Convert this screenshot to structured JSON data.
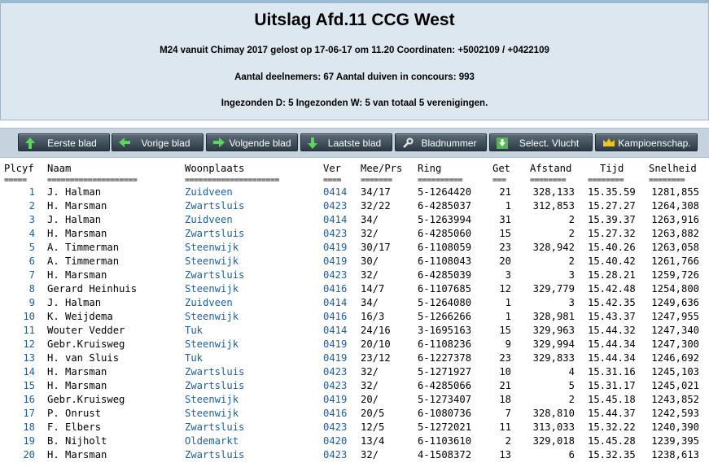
{
  "title": "Uitslag Afd.11 CCG West",
  "info_line1": "M24 vanuit Chimay 2017 gelost op 17-06-17 om 11.20 Coordinaten: +5002109 / +0422109",
  "info_line2": "Aantal deelnemers: 67 Aantal duiven in concours: 993",
  "info_line3": "Ingezonden D: 5 Ingezonden W: 5 van totaal 5 verenigingen.",
  "nav": [
    {
      "label": "Eerste blad",
      "icon": "arrow-up-icon"
    },
    {
      "label": "Vorige blad",
      "icon": "arrow-left-icon"
    },
    {
      "label": "Volgende blad",
      "icon": "arrow-right-icon"
    },
    {
      "label": "Laatste blad",
      "icon": "arrow-down-icon"
    },
    {
      "label": "Bladnummer",
      "icon": "wrench-icon"
    },
    {
      "label": "Select. Vlucht",
      "icon": "download-icon"
    },
    {
      "label": "Kampioenschap.",
      "icon": "crown-icon"
    }
  ],
  "columns": {
    "plcyf": "Plcyf",
    "naam": "Naam",
    "woonplaats": "Woonplaats",
    "ver": "Ver",
    "meeprs": "Mee/Prs",
    "ring": "Ring",
    "get": "Get",
    "afstand": "Afstand",
    "tijd": "Tijd",
    "snelheid": "Snelheid"
  },
  "separators": {
    "plcyf": "=====",
    "naam": "====================",
    "woonplaats": "=====================",
    "ver": "====",
    "meeprs": "=======",
    "ring": "==========",
    "get": "===",
    "afstand": "========",
    "tijd": "========",
    "snelheid": "========"
  },
  "rows": [
    {
      "plcyf": "1",
      "naam": "J. Halman",
      "woonplaats": "Zuidveen",
      "ver": "0414",
      "meeprs": "34/17",
      "ring": "5-1264420",
      "get": "21",
      "afstand": "328,133",
      "tijd": "15.35.59",
      "snelheid": "1281,855"
    },
    {
      "plcyf": "2",
      "naam": "H. Marsman",
      "woonplaats": "Zwartsluis",
      "ver": "0423",
      "meeprs": "32/22",
      "ring": "6-4285037",
      "get": "1",
      "afstand": "312,853",
      "tijd": "15.27.27",
      "snelheid": "1264,308"
    },
    {
      "plcyf": "3",
      "naam": "J. Halman",
      "woonplaats": "Zuidveen",
      "ver": "0414",
      "meeprs": "34/",
      "ring": "5-1263994",
      "get": "31",
      "afstand": "2",
      "tijd": "15.39.37",
      "snelheid": "1263,916"
    },
    {
      "plcyf": "4",
      "naam": "H. Marsman",
      "woonplaats": "Zwartsluis",
      "ver": "0423",
      "meeprs": "32/",
      "ring": "6-4285060",
      "get": "15",
      "afstand": "2",
      "tijd": "15.27.32",
      "snelheid": "1263,882"
    },
    {
      "plcyf": "5",
      "naam": "A. Timmerman",
      "woonplaats": "Steenwijk",
      "ver": "0419",
      "meeprs": "30/17",
      "ring": "6-1108059",
      "get": "23",
      "afstand": "328,942",
      "tijd": "15.40.26",
      "snelheid": "1263,058"
    },
    {
      "plcyf": "6",
      "naam": "A. Timmerman",
      "woonplaats": "Steenwijk",
      "ver": "0419",
      "meeprs": "30/",
      "ring": "6-1108043",
      "get": "20",
      "afstand": "2",
      "tijd": "15.40.42",
      "snelheid": "1261,766"
    },
    {
      "plcyf": "7",
      "naam": "H. Marsman",
      "woonplaats": "Zwartsluis",
      "ver": "0423",
      "meeprs": "32/",
      "ring": "6-4285039",
      "get": "3",
      "afstand": "3",
      "tijd": "15.28.21",
      "snelheid": "1259,726"
    },
    {
      "plcyf": "8",
      "naam": "Gerard Heinhuis",
      "woonplaats": "Steenwijk",
      "ver": "0416",
      "meeprs": "14/7",
      "ring": "6-1107685",
      "get": "12",
      "afstand": "329,779",
      "tijd": "15.42.48",
      "snelheid": "1254,800"
    },
    {
      "plcyf": "9",
      "naam": "J. Halman",
      "woonplaats": "Zuidveen",
      "ver": "0414",
      "meeprs": "34/",
      "ring": "5-1264080",
      "get": "1",
      "afstand": "3",
      "tijd": "15.42.35",
      "snelheid": "1249,636"
    },
    {
      "plcyf": "10",
      "naam": "K. Weijdema",
      "woonplaats": "Steenwijk",
      "ver": "0416",
      "meeprs": "16/3",
      "ring": "5-1266266",
      "get": "1",
      "afstand": "328,981",
      "tijd": "15.43.37",
      "snelheid": "1247,955"
    },
    {
      "plcyf": "11",
      "naam": "Wouter Vedder",
      "woonplaats": "Tuk",
      "ver": "0414",
      "meeprs": "24/16",
      "ring": "3-1695163",
      "get": "15",
      "afstand": "329,963",
      "tijd": "15.44.32",
      "snelheid": "1247,340"
    },
    {
      "plcyf": "12",
      "naam": "Gebr.Kruisweg",
      "woonplaats": "Steenwijk",
      "ver": "0419",
      "meeprs": "20/10",
      "ring": "6-1108236",
      "get": "9",
      "afstand": "329,994",
      "tijd": "15.44.34",
      "snelheid": "1247,300"
    },
    {
      "plcyf": "13",
      "naam": "H. van Sluis",
      "woonplaats": "Tuk",
      "ver": "0419",
      "meeprs": "23/12",
      "ring": "6-1227378",
      "get": "23",
      "afstand": "329,833",
      "tijd": "15.44.34",
      "snelheid": "1246,692"
    },
    {
      "plcyf": "14",
      "naam": "H. Marsman",
      "woonplaats": "Zwartsluis",
      "ver": "0423",
      "meeprs": "32/",
      "ring": "5-1271927",
      "get": "10",
      "afstand": "4",
      "tijd": "15.31.16",
      "snelheid": "1245,103"
    },
    {
      "plcyf": "15",
      "naam": "H. Marsman",
      "woonplaats": "Zwartsluis",
      "ver": "0423",
      "meeprs": "32/",
      "ring": "6-4285066",
      "get": "21",
      "afstand": "5",
      "tijd": "15.31.17",
      "snelheid": "1245,021"
    },
    {
      "plcyf": "16",
      "naam": "Gebr.Kruisweg",
      "woonplaats": "Steenwijk",
      "ver": "0419",
      "meeprs": "20/",
      "ring": "5-1273407",
      "get": "18",
      "afstand": "2",
      "tijd": "15.45.18",
      "snelheid": "1243,852"
    },
    {
      "plcyf": "17",
      "naam": "P. Onrust",
      "woonplaats": "Steenwijk",
      "ver": "0416",
      "meeprs": "20/5",
      "ring": "6-1080736",
      "get": "7",
      "afstand": "328,810",
      "tijd": "15.44.37",
      "snelheid": "1242,593"
    },
    {
      "plcyf": "18",
      "naam": "F. Elbers",
      "woonplaats": "Zwartsluis",
      "ver": "0423",
      "meeprs": "12/5",
      "ring": "5-1272021",
      "get": "11",
      "afstand": "313,033",
      "tijd": "15.32.22",
      "snelheid": "1240,390"
    },
    {
      "plcyf": "19",
      "naam": "B. Nijholt",
      "woonplaats": "Oldemarkt",
      "ver": "0420",
      "meeprs": "13/4",
      "ring": "6-1103610",
      "get": "2",
      "afstand": "329,018",
      "tijd": "15.45.28",
      "snelheid": "1239,395"
    },
    {
      "plcyf": "20",
      "naam": "H. Marsman",
      "woonplaats": "Zwartsluis",
      "ver": "0423",
      "meeprs": "32/",
      "ring": "4-1508372",
      "get": "13",
      "afstand": "6",
      "tijd": "15.32.35",
      "snelheid": "1238,613"
    }
  ]
}
